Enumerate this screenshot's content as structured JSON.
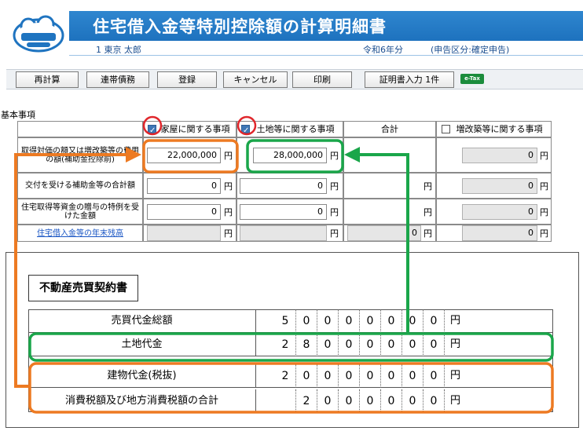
{
  "header": {
    "logo": "みんなの確定申告クラウド",
    "title": "住宅借入金等特別控除額の計算明細書",
    "user": "1 東京 太郎",
    "tax_year": "令和6年分",
    "filing_type": "(申告区分:確定申告)"
  },
  "toolbar": {
    "recalc": "再計算",
    "joint_debt": "連帯債務",
    "register": "登録",
    "cancel": "キャンセル",
    "print": "印刷",
    "certificate_input": "証明書入力 1件",
    "etax": "e-Tax"
  },
  "form": {
    "section": "基本事項",
    "columns": {
      "house": "家屋に関する事項",
      "land": "土地等に関する事項",
      "total": "合計",
      "extension": "増改築等に関する事項"
    },
    "column_checked": {
      "house": true,
      "land": true,
      "extension": false
    },
    "yen": "円",
    "rows": [
      {
        "label": "取得対価の額又は増改築等の費用の額(補助金控除前)",
        "house": "22,000,000",
        "land": "28,000,000",
        "total": "",
        "extension": "0"
      },
      {
        "label": "交付を受ける補助金等の合計額",
        "house": "0",
        "land": "0",
        "total": "",
        "extension": "0"
      },
      {
        "label": "住宅取得等資金の贈与の特例を受けた金額",
        "house": "0",
        "land": "0",
        "total": "",
        "extension": "0"
      },
      {
        "label": "住宅借入金等の年末残高",
        "house": "",
        "land": "",
        "total": "0",
        "extension": "0"
      }
    ]
  },
  "contract": {
    "title": "不動産売買契約書",
    "yen": "円",
    "rows": [
      {
        "label": "売買代金総額",
        "digits": [
          "5",
          "0",
          "0",
          "0",
          "0",
          "0",
          "0",
          "0"
        ]
      },
      {
        "label": "土地代金",
        "digits": [
          "2",
          "8",
          "0",
          "0",
          "0",
          "0",
          "0",
          "0"
        ]
      },
      {
        "label": "建物代金(税抜)",
        "digits": [
          "2",
          "0",
          "0",
          "0",
          "0",
          "0",
          "0",
          "0"
        ]
      },
      {
        "label": "消費税額及び地方消費税額の合計",
        "digits": [
          "",
          "2",
          "0",
          "0",
          "0",
          "0",
          "0",
          "0"
        ]
      }
    ]
  },
  "colors": {
    "header_blue": "#1f74c0",
    "orange_highlight": "#ed7a22",
    "green_highlight": "#1aa64a",
    "red_circle": "#e0262b"
  }
}
